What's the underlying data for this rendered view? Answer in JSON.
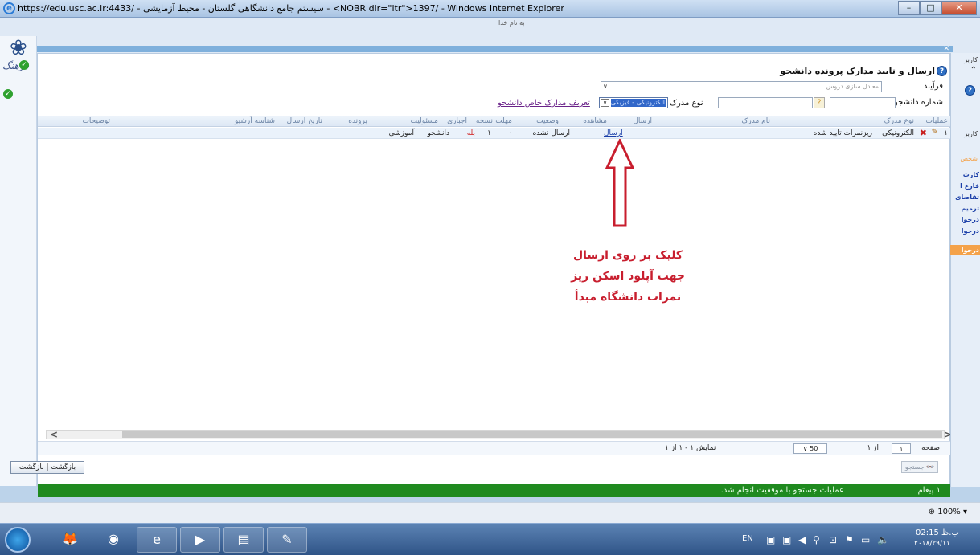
{
  "window": {
    "title": "https://edu.usc.ac.ir:4433/ - سیستم جامع دانشگاهی گلستان - محیط آزمایشی - <NOBR dir=\"ltr\">1397/ - Windows Internet Explorer",
    "min": "–",
    "max": "□",
    "close": "✕"
  },
  "welcome": "به نام خدا",
  "leftcol": {
    "logo_word": "فرهنگ"
  },
  "form": {
    "title": "ارسال و تایید مدارک پرونده دانشجو",
    "process_label": "فرآیند",
    "process_value": "معادل سازی دروس",
    "student_no_label": "شماره دانشجو",
    "doc_type_label": "نوع مدرک",
    "doc_type_value": "الکترونیکی - فیزیکی",
    "define_link": "تعریف مدارک خاص دانشجو"
  },
  "table": {
    "headers": {
      "ops": "عملیات",
      "doc_type": "نوع مدرک",
      "doc_name": "نام مدرک",
      "send": "ارسال",
      "view": "مشاهده",
      "status": "وضعیت",
      "copies": "نسخه",
      "deadline": "مهلت",
      "mandatory": "اجباری",
      "responsible": "مسئولیت",
      "file": "پرونده",
      "send_date": "تاریخ ارسال",
      "archive_id": "شناسه آرشیو",
      "notes": "توضیحات"
    },
    "rows": [
      {
        "index": "۱",
        "doc_type": "الکترونیکی",
        "doc_name": "ریزنمرات تایید شده",
        "send": "ارسال",
        "status": "ارسال نشده",
        "copies": "۱",
        "deadline": "۰",
        "mandatory": "بله",
        "responsible": "دانشجو",
        "file": "آموزشی"
      }
    ]
  },
  "annotation": {
    "line1": "کلیک بر روی ارسال",
    "line2": "جهت آپلود اسکن ریز",
    "line3": "نمرات دانشگاه مبدأ"
  },
  "right_side": {
    "t1": "کاربر",
    "t2": "کاربر",
    "t3": "شخص",
    "links": [
      "کارت",
      "فارغ ا",
      "تقاضای",
      "ترمیم",
      "درخوا",
      "درخوا",
      "درخوا"
    ]
  },
  "pager": {
    "page_label": "صفحه",
    "page_value": "۱",
    "of_label": "از ۱",
    "page_size": "50",
    "showing": "نمایش ۱ - ۱ از ۱"
  },
  "buttons": {
    "back": "بازگشت",
    "back2": "بازگشت",
    "search": "جستجو"
  },
  "status": {
    "message_count": "۱ پیغام",
    "message": "عملیات جستجو با موفقیت انجام شد."
  },
  "ie": {
    "zoom": "100%"
  },
  "taskbar": {
    "lang": "EN",
    "time": "02:15",
    "ampm": "ب.ظ",
    "date": "۲۰۱۸/۲۹/۱۱"
  }
}
